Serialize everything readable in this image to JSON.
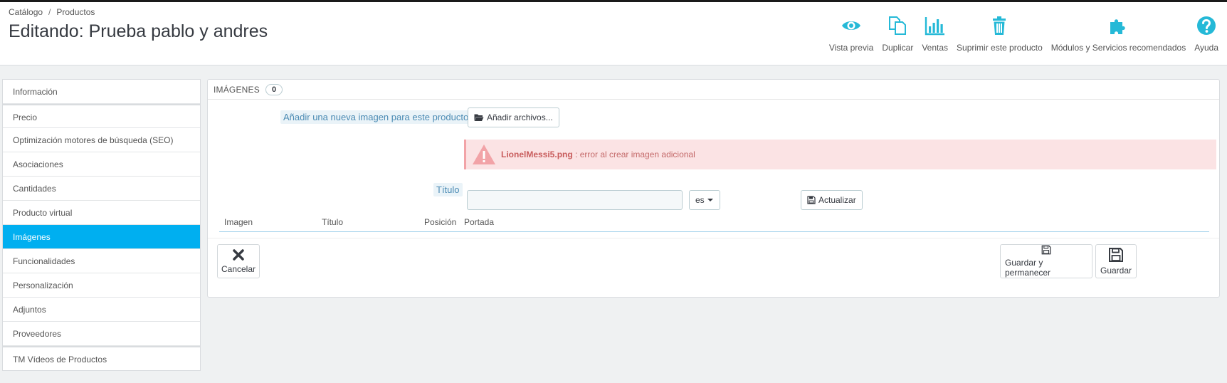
{
  "breadcrumb": {
    "root": "Catálogo",
    "separator": "/",
    "current": "Productos"
  },
  "page": {
    "title": "Editando: Prueba pablo y andres"
  },
  "toolbar": {
    "preview": "Vista previa",
    "duplicate": "Duplicar",
    "sales": "Ventas",
    "delete": "Suprimir este producto",
    "modules": "Módulos y Servicios recomendados",
    "help": "Ayuda"
  },
  "colors": {
    "accent": "#25b9d7",
    "active_tab": "#00aff0",
    "error_bg": "#fbe3e4",
    "error_icon": "#f2a3a7"
  },
  "sidebar": {
    "items": [
      {
        "label": "Información"
      },
      {
        "label": "Precio"
      },
      {
        "label": "Optimización motores de búsqueda (SEO)"
      },
      {
        "label": "Asociaciones"
      },
      {
        "label": "Cantidades"
      },
      {
        "label": "Producto virtual"
      },
      {
        "label": "Imágenes"
      },
      {
        "label": "Funcionalidades"
      },
      {
        "label": "Personalización"
      },
      {
        "label": "Adjuntos"
      },
      {
        "label": "Proveedores"
      },
      {
        "label": "TM Vídeos de Productos"
      }
    ],
    "active": "Imágenes"
  },
  "images_panel": {
    "title": "IMÁGENES",
    "count": "0",
    "add_label": "Añadir una nueva imagen para este producto",
    "add_button": "Añadir archivos...",
    "error_file": "LionelMessi5.png",
    "error_message": " : error al crear imagen adicional",
    "title_label": "Título",
    "title_value": "",
    "lang": "es",
    "update_button": "Actualizar",
    "columns": [
      "Imagen",
      "Título",
      "Posición",
      "Portada"
    ]
  },
  "footer": {
    "cancel": "Cancelar",
    "save_stay": "Guardar y permanecer",
    "save": "Guardar"
  },
  "icons": {
    "preview": "eye-icon",
    "duplicate": "copy-icon",
    "sales": "bar-chart-icon",
    "delete": "trash-icon",
    "modules": "puzzle-icon",
    "help": "question-icon",
    "folder": "folder-open-icon",
    "warning": "warning-icon",
    "save": "floppy-icon",
    "cancel": "close-icon"
  }
}
